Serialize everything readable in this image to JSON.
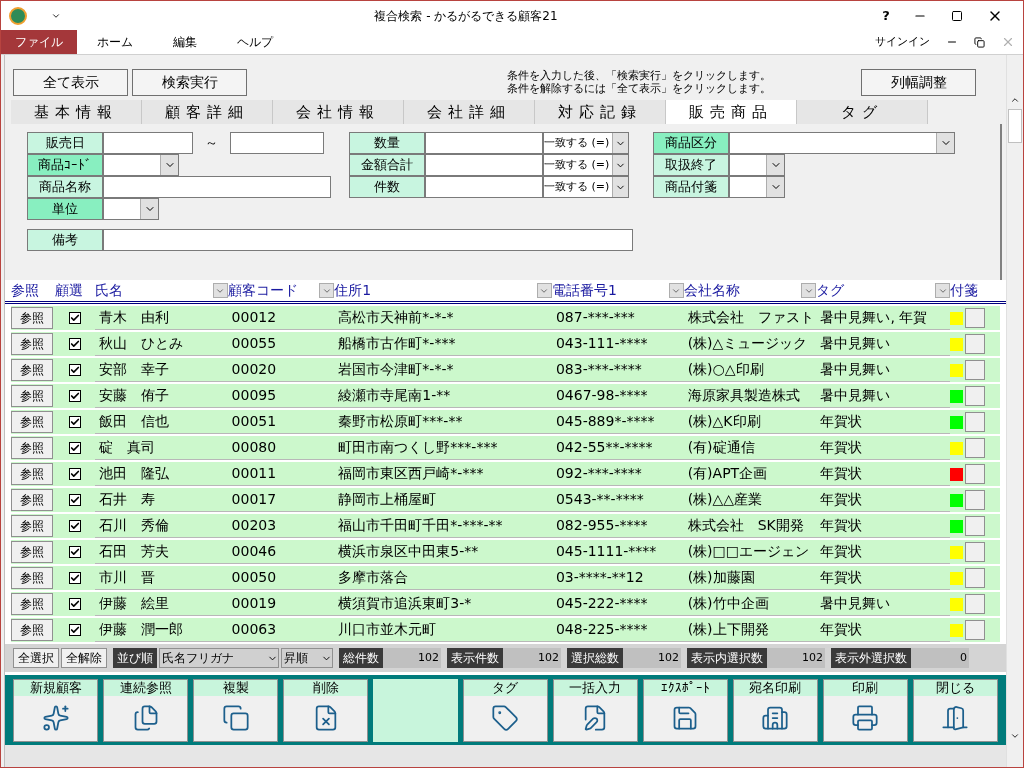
{
  "window": {
    "title": "複合検索 - かるがるできる顧客21",
    "help": "?",
    "signin": "サインイン"
  },
  "menu": [
    {
      "label": "ファイル",
      "selected": true
    },
    {
      "label": "ホーム",
      "selected": false
    },
    {
      "label": "編集",
      "selected": false
    },
    {
      "label": "ヘルプ",
      "selected": false
    }
  ],
  "actions": {
    "show_all": "全て表示",
    "search": "検索実行",
    "hint_lines": [
      "条件を入力した後、「検索実行」をクリックします。",
      "条件を解除するには「全て表示」をクリックします。"
    ],
    "fit_columns": "列幅調整"
  },
  "tabs": [
    {
      "label": "基本情報",
      "selected": false
    },
    {
      "label": "顧客詳細",
      "selected": false
    },
    {
      "label": "会社情報",
      "selected": false
    },
    {
      "label": "会社詳細",
      "selected": false
    },
    {
      "label": "対応記録",
      "selected": false
    },
    {
      "label": "販売商品",
      "selected": true
    },
    {
      "label": "タグ",
      "selected": false
    }
  ],
  "form": {
    "left": [
      {
        "label": "販売日",
        "kind": "range",
        "emphasized": false,
        "separator": "～"
      },
      {
        "label": "商品ｺｰﾄﾞ",
        "kind": "code-combo",
        "emphasized": true
      },
      {
        "label": "商品名称",
        "kind": "text",
        "emphasized": false
      },
      {
        "label": "単位",
        "kind": "small-combo",
        "emphasized": true
      }
    ],
    "middle": [
      {
        "label": "数量",
        "kind": "compare",
        "emphasized": false,
        "operator": "一致する (=)"
      },
      {
        "label": "金額合計",
        "kind": "compare",
        "emphasized": false,
        "operator": "一致する (=)"
      },
      {
        "label": "件数",
        "kind": "compare",
        "emphasized": false,
        "operator": "一致する (=)"
      }
    ],
    "right": [
      {
        "label": "商品区分",
        "kind": "wide-combo",
        "emphasized": true
      },
      {
        "label": "取扱終了",
        "kind": "small-combo",
        "emphasized": false
      },
      {
        "label": "商品付箋",
        "kind": "small-combo",
        "emphasized": false
      }
    ],
    "note": {
      "label": "備考",
      "kind": "note",
      "emphasized": false
    }
  },
  "table": {
    "columns": [
      "参照",
      "顧選",
      "氏名",
      "顧客コード",
      "住所1",
      "電話番号1",
      "会社名称",
      "タグ",
      "付箋"
    ],
    "rows": [
      {
        "ref": "参照",
        "checked": true,
        "name": "青木　由利",
        "code": "00012",
        "address": "高松市天神前*-*-*",
        "phone": "087-***-***",
        "company": "株式会社　ファスト",
        "tag": "暑中見舞い, 年賀",
        "color": "#ffff00"
      },
      {
        "ref": "参照",
        "checked": true,
        "name": "秋山　ひとみ",
        "code": "00055",
        "address": "船橋市古作町*-***",
        "phone": "043-111-****",
        "company": "(株)△ミュージック",
        "tag": "暑中見舞い",
        "color": "#ffff00"
      },
      {
        "ref": "参照",
        "checked": true,
        "name": "安部　幸子",
        "code": "00020",
        "address": "岩国市今津町*-*-*",
        "phone": "083-***-****",
        "company": "(株)○△印刷",
        "tag": "暑中見舞い",
        "color": "#ffff00"
      },
      {
        "ref": "参照",
        "checked": true,
        "name": "安藤　侑子",
        "code": "00095",
        "address": "綾瀬市寺尾南1-**",
        "phone": "0467-98-****",
        "company": "海原家具製造株式",
        "tag": "暑中見舞い",
        "color": "#00ff00"
      },
      {
        "ref": "参照",
        "checked": true,
        "name": "飯田　信也",
        "code": "00051",
        "address": "秦野市松原町***-**",
        "phone": "045-889*-****",
        "company": "(株)△K印刷",
        "tag": "年賀状",
        "color": "#00ff00"
      },
      {
        "ref": "参照",
        "checked": true,
        "name": "碇　真司",
        "code": "00080",
        "address": "町田市南つくし野***-***",
        "phone": "042-55**-****",
        "company": "(有)碇通信",
        "tag": "年賀状",
        "color": "#ffff00"
      },
      {
        "ref": "参照",
        "checked": true,
        "name": "池田　隆弘",
        "code": "00011",
        "address": "福岡市東区西戸崎*-***",
        "phone": "092-***-****",
        "company": "(有)APT企画",
        "tag": "年賀状",
        "color": "#ff0000"
      },
      {
        "ref": "参照",
        "checked": true,
        "name": "石井　寿",
        "code": "00017",
        "address": "静岡市上桶屋町",
        "phone": "0543-**-****",
        "company": "(株)△△産業",
        "tag": "年賀状",
        "color": "#00ff00"
      },
      {
        "ref": "参照",
        "checked": true,
        "name": "石川　秀倫",
        "code": "00203",
        "address": "福山市千田町千田*-***-**",
        "phone": "082-955-****",
        "company": "株式会社　SK開発",
        "tag": "年賀状",
        "color": "#00ff00"
      },
      {
        "ref": "参照",
        "checked": true,
        "name": "石田　芳夫",
        "code": "00046",
        "address": "横浜市泉区中田東5-**",
        "phone": "045-1111-****",
        "company": "(株)□□エージェン",
        "tag": "年賀状",
        "color": "#ffff00"
      },
      {
        "ref": "参照",
        "checked": true,
        "name": "市川　晋",
        "code": "00050",
        "address": "多摩市落合",
        "phone": "03-****-**12",
        "company": "(株)加藤園",
        "tag": "年賀状",
        "color": "#ffff00"
      },
      {
        "ref": "参照",
        "checked": true,
        "name": "伊藤　絵里",
        "code": "00019",
        "address": "横須賀市追浜東町3-*",
        "phone": "045-222-****",
        "company": "(株)竹中企画",
        "tag": "暑中見舞い",
        "color": "#ffff00"
      },
      {
        "ref": "参照",
        "checked": true,
        "name": "伊藤　潤一郎",
        "code": "00063",
        "address": "川口市並木元町",
        "phone": "048-225-****",
        "company": "(株)上下開発",
        "tag": "年賀状",
        "color": "#ffff00"
      }
    ]
  },
  "footer": {
    "select_all": "全選択",
    "clear_all": "全解除",
    "sort_label": "並び順",
    "sort_field": "氏名フリガナ",
    "sort_order": "昇順",
    "counts": [
      {
        "label": "総件数",
        "value": "102"
      },
      {
        "label": "表示件数",
        "value": "102"
      },
      {
        "label": "選択総数",
        "value": "102"
      },
      {
        "label": "表示内選択数",
        "value": "102"
      },
      {
        "label": "表示外選択数",
        "value": "0"
      }
    ]
  },
  "toolbar": [
    {
      "kind": "button",
      "label": "新規顧客"
    },
    {
      "kind": "button",
      "label": "連続参照"
    },
    {
      "kind": "button",
      "label": "複製"
    },
    {
      "kind": "button",
      "label": "削除"
    },
    {
      "kind": "blank"
    },
    {
      "kind": "button",
      "label": "タグ"
    },
    {
      "kind": "button",
      "label": "一括入力"
    },
    {
      "kind": "button",
      "label": "ｴｸｽﾎﾟｰﾄ"
    },
    {
      "kind": "button",
      "label": "宛名印刷"
    },
    {
      "kind": "button",
      "label": "印刷"
    },
    {
      "kind": "button",
      "label": "閉じる"
    }
  ]
}
